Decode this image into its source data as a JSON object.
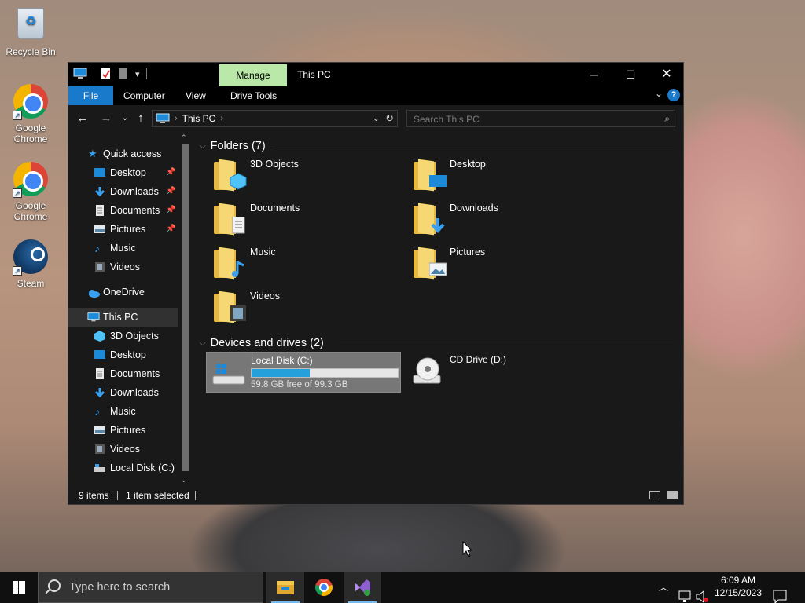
{
  "desktop": {
    "icons": [
      {
        "label": "Recycle Bin"
      },
      {
        "label": "Google Chrome"
      },
      {
        "label": "Google Chrome"
      },
      {
        "label": "Steam"
      }
    ]
  },
  "window": {
    "contextual_tab": "Manage",
    "title": "This PC",
    "ribbon_tabs": [
      "File",
      "Computer",
      "View",
      "Drive Tools"
    ],
    "address": {
      "crumb": "This PC"
    },
    "search": {
      "placeholder": "Search This PC"
    },
    "nav": {
      "quick_access": "Quick access",
      "quick_items": [
        "Desktop",
        "Downloads",
        "Documents",
        "Pictures",
        "Music",
        "Videos"
      ],
      "onedrive": "OneDrive",
      "this_pc": "This PC",
      "pc_items": [
        "3D Objects",
        "Desktop",
        "Documents",
        "Downloads",
        "Music",
        "Pictures",
        "Videos",
        "Local Disk (C:)"
      ]
    },
    "folders_header": "Folders (7)",
    "folders": [
      "3D Objects",
      "Desktop",
      "Documents",
      "Downloads",
      "Music",
      "Pictures",
      "Videos"
    ],
    "drives_header": "Devices and drives (2)",
    "drives": [
      {
        "name": "Local Disk (C:)",
        "free_text": "59.8 GB free of 99.3 GB",
        "used_fraction": 0.398
      },
      {
        "name": "CD Drive (D:)"
      }
    ],
    "status": {
      "items": "9 items",
      "selected": "1 item selected"
    }
  },
  "taskbar": {
    "search_placeholder": "Type here to search",
    "time": "6:09 AM",
    "date": "12/15/2023"
  },
  "colors": {
    "accent": "#1979ca",
    "manage_tab": "#b9e8a8",
    "drive_bar": "#26a0da"
  }
}
